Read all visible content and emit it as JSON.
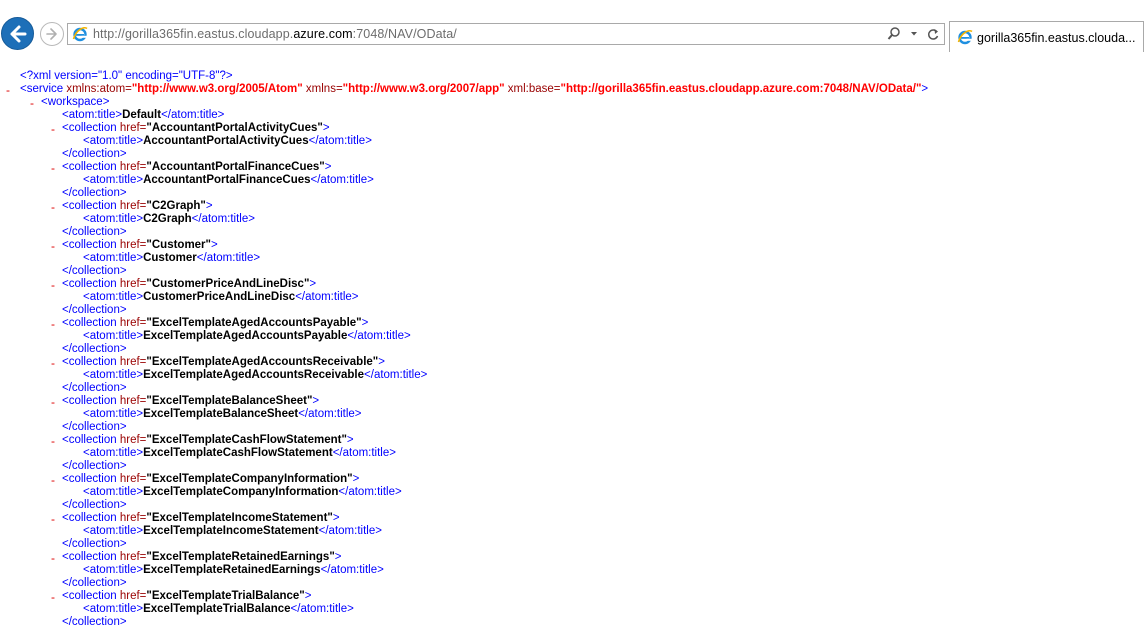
{
  "browser": {
    "url_prefix": "http://gorilla365fin.eastus.cloudapp.",
    "url_domain": "azure.com",
    "url_suffix": ":7048/NAV/OData/",
    "tab_title": "gorilla365fin.eastus.clouda...",
    "search_icon": "search-icon",
    "refresh_icon": "refresh-icon"
  },
  "xml": {
    "declaration": "<?xml version=\"1.0\" encoding=\"UTF-8\"?>",
    "collapse_marker": "-",
    "service": {
      "tag": "<service",
      "attr1_name": " xmlns:atom=",
      "attr1_value": "\"http://www.w3.org/2005/Atom\"",
      "attr2_name": " xmlns=",
      "attr2_value": "\"http://www.w3.org/2007/app\"",
      "attr3_name": " xml:base=",
      "attr3_value": "\"http://gorilla365fin.eastus.cloudapp.azure.com:7048/NAV/OData/\"",
      "close": ">"
    },
    "workspace_tag": "<workspace",
    "workspace_close": ">",
    "atom_title_open": "<atom:title",
    "atom_title_close": "</atom:title",
    "gt": ">",
    "workspace_title": "Default",
    "collection_open": "<collection",
    "href_attr": " href=",
    "collection_close": "</collection",
    "collections": [
      {
        "href": "\"AccountantPortalActivityCues\"",
        "title": "AccountantPortalActivityCues"
      },
      {
        "href": "\"AccountantPortalFinanceCues\"",
        "title": "AccountantPortalFinanceCues"
      },
      {
        "href": "\"C2Graph\"",
        "title": "C2Graph"
      },
      {
        "href": "\"Customer\"",
        "title": "Customer"
      },
      {
        "href": "\"CustomerPriceAndLineDisc\"",
        "title": "CustomerPriceAndLineDisc"
      },
      {
        "href": "\"ExcelTemplateAgedAccountsPayable\"",
        "title": "ExcelTemplateAgedAccountsPayable"
      },
      {
        "href": "\"ExcelTemplateAgedAccountsReceivable\"",
        "title": "ExcelTemplateAgedAccountsReceivable"
      },
      {
        "href": "\"ExcelTemplateBalanceSheet\"",
        "title": "ExcelTemplateBalanceSheet"
      },
      {
        "href": "\"ExcelTemplateCashFlowStatement\"",
        "title": "ExcelTemplateCashFlowStatement"
      },
      {
        "href": "\"ExcelTemplateCompanyInformation\"",
        "title": "ExcelTemplateCompanyInformation"
      },
      {
        "href": "\"ExcelTemplateIncomeStatement\"",
        "title": "ExcelTemplateIncomeStatement"
      },
      {
        "href": "\"ExcelTemplateRetainedEarnings\"",
        "title": "ExcelTemplateRetainedEarnings"
      },
      {
        "href": "\"ExcelTemplateTrialBalance\"",
        "title": "ExcelTemplateTrialBalance"
      }
    ]
  }
}
